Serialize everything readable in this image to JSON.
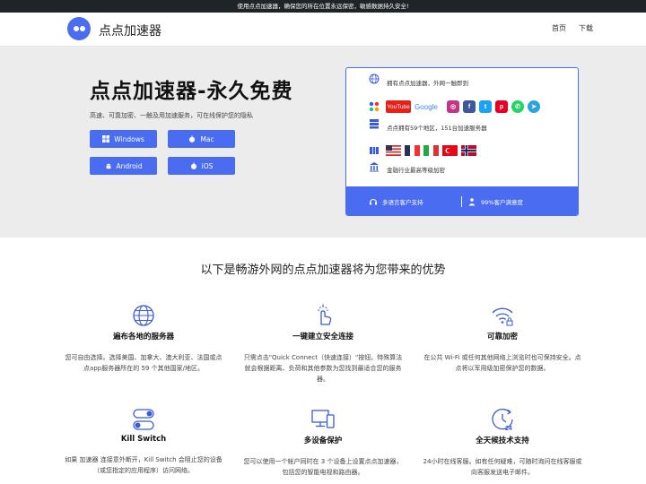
{
  "topbar": {
    "notice": "使用点点加速器，确保您的所在位置永远保密，敏感数据持久安全!"
  },
  "nav": {
    "brand": "点点加速器",
    "links": [
      "首页",
      "下载"
    ]
  },
  "hero": {
    "title": "点点加速器-永久免费",
    "subtitle": "高速、可靠加密、一触及用加速服务，可在线保护您的隐私",
    "buttons": [
      "Windows",
      "Mac",
      "Android",
      "iOS"
    ]
  },
  "card": {
    "row1": "拥有点点加速器，外网一触即到",
    "social": [
      "YouTube",
      "Google",
      "Instagram",
      "Facebook",
      "Twitter",
      "Pinterest",
      "WhatsApp",
      "Telegram"
    ],
    "row3": "点点拥有59个地区，151台加速服务器",
    "flags": [
      "United States",
      "France",
      "Italy",
      "Turkey",
      "Norway"
    ],
    "row5": "金融行业最高等级加密",
    "footer": [
      "多语言客户支持",
      "99%客户满意度"
    ]
  },
  "section": {
    "title": "以下是畅游外网的点点加速器将为您带来的优势"
  },
  "features": [
    {
      "icon": "globe-icon",
      "name": "遍布各地的服务器",
      "desc": "您可自由选择。选择美国、加拿大、澳大利亚、法国或点点app服务器所在的 59 个其他国家/地区。"
    },
    {
      "icon": "tap-icon",
      "name": "一键建立安全连接",
      "desc": "只需点击\"Quick Connect（快速连接）\"按钮。特殊算法就会根据距离、负荷和其他参数为您找到最适合您的服务器。"
    },
    {
      "icon": "wifi-lock-icon",
      "name": "可靠加密",
      "desc": "在公共 Wi-Fi 或任何其他网络上浏览时也可保持安全。点点将以军用级加密保护您的数据。"
    },
    {
      "icon": "toggle-icon",
      "name": "Kill Switch",
      "desc": "如果 加速器 连接意外断开，Kill Switch 会阻止您的设备（或您指定的应用程序）访问网络。"
    },
    {
      "icon": "devices-icon",
      "name": "多设备保护",
      "desc": "您可以使用一个帐户同时在 3 个设备上设置点点加速器，包括您的智能电视和路由器。"
    },
    {
      "icon": "support-24-icon",
      "name": "全天候技术支持",
      "desc": "24小时在线客服。如有任何疑难，可随时询问在线客服或向客服发送电子邮件。"
    }
  ],
  "colors": {
    "accent": "#4a6cf0",
    "hero_bg": "#ececec",
    "topbar_bg": "#1f2428"
  }
}
